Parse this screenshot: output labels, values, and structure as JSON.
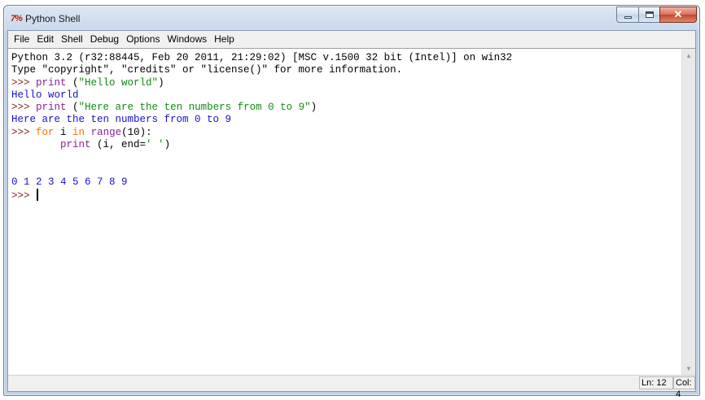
{
  "window": {
    "title": "Python Shell",
    "app_icon": "7%"
  },
  "titlebar_buttons": {
    "minimize": "minimize-icon",
    "maximize": "maximize-icon",
    "close": "close-icon"
  },
  "menu": [
    "File",
    "Edit",
    "Shell",
    "Debug",
    "Options",
    "Windows",
    "Help"
  ],
  "shell": {
    "lines": [
      [
        {
          "t": "Python 3.2 (r32:88445, Feb 20 2011, 21:29:02) [MSC v.1500 32 bit (Intel)] on win32",
          "c": "black"
        }
      ],
      [
        {
          "t": "Type \"copyright\", \"credits\" or \"license()\" for more information.",
          "c": "black"
        }
      ],
      [
        {
          "t": ">>> ",
          "c": "prompt"
        },
        {
          "t": "print",
          "c": "purple"
        },
        {
          "t": " (",
          "c": "black"
        },
        {
          "t": "\"Hello world\"",
          "c": "green"
        },
        {
          "t": ")",
          "c": "black"
        }
      ],
      [
        {
          "t": "Hello world",
          "c": "blue"
        }
      ],
      [
        {
          "t": ">>> ",
          "c": "prompt"
        },
        {
          "t": "print",
          "c": "purple"
        },
        {
          "t": " (",
          "c": "black"
        },
        {
          "t": "\"Here are the ten numbers from 0 to 9\"",
          "c": "green"
        },
        {
          "t": ")",
          "c": "black"
        }
      ],
      [
        {
          "t": "Here are the ten numbers from 0 to 9",
          "c": "blue"
        }
      ],
      [
        {
          "t": ">>> ",
          "c": "prompt"
        },
        {
          "t": "for",
          "c": "orange"
        },
        {
          "t": " i ",
          "c": "black"
        },
        {
          "t": "in",
          "c": "orange"
        },
        {
          "t": " ",
          "c": "black"
        },
        {
          "t": "range",
          "c": "purple"
        },
        {
          "t": "(10):",
          "c": "black"
        }
      ],
      [
        {
          "t": "        ",
          "c": "black"
        },
        {
          "t": "print",
          "c": "purple"
        },
        {
          "t": " (i, end=",
          "c": "black"
        },
        {
          "t": "' '",
          "c": "green"
        },
        {
          "t": ")",
          "c": "black"
        }
      ],
      [],
      [],
      [
        {
          "t": "0 1 2 3 4 5 6 7 8 9",
          "c": "blue"
        }
      ],
      [
        {
          "t": ">>> ",
          "c": "prompt"
        }
      ]
    ]
  },
  "colors": {
    "black": "#000000",
    "prompt": "#7a1f15",
    "blue": "#1414c8",
    "green": "#138a13",
    "orange": "#ee7700",
    "purple": "#8a2190"
  },
  "status": {
    "line": "Ln: 12",
    "col": "Col: 4"
  }
}
